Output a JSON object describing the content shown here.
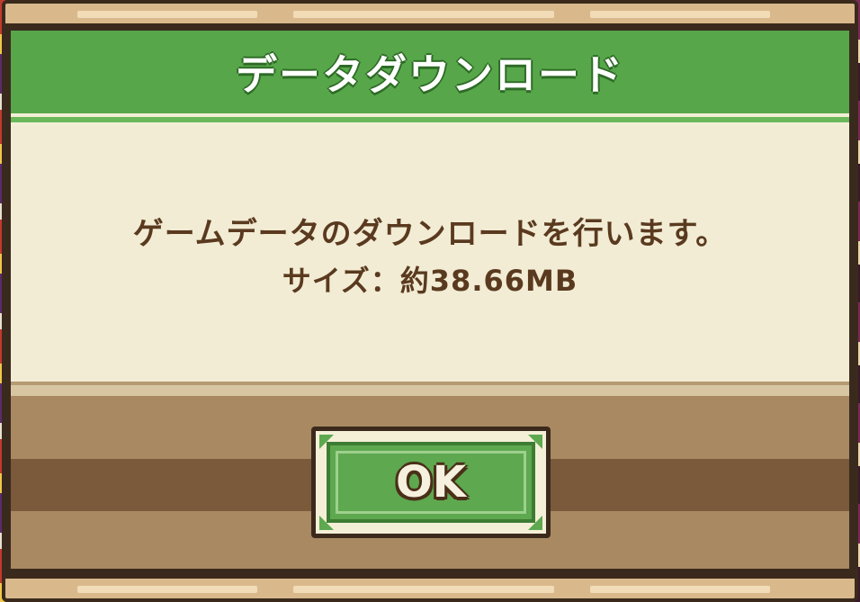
{
  "dialog": {
    "title": "データダウンロード",
    "message": "ゲームデータのダウンロードを行います。",
    "size_text": "サイズ：約38.66MB",
    "ok_label": "OK"
  },
  "colors": {
    "header_green": "#57a74a",
    "body_cream": "#f2ecd5",
    "text_brown": "#5a3a1f",
    "wood": "#a98962",
    "button_green": "#5ea84f"
  }
}
